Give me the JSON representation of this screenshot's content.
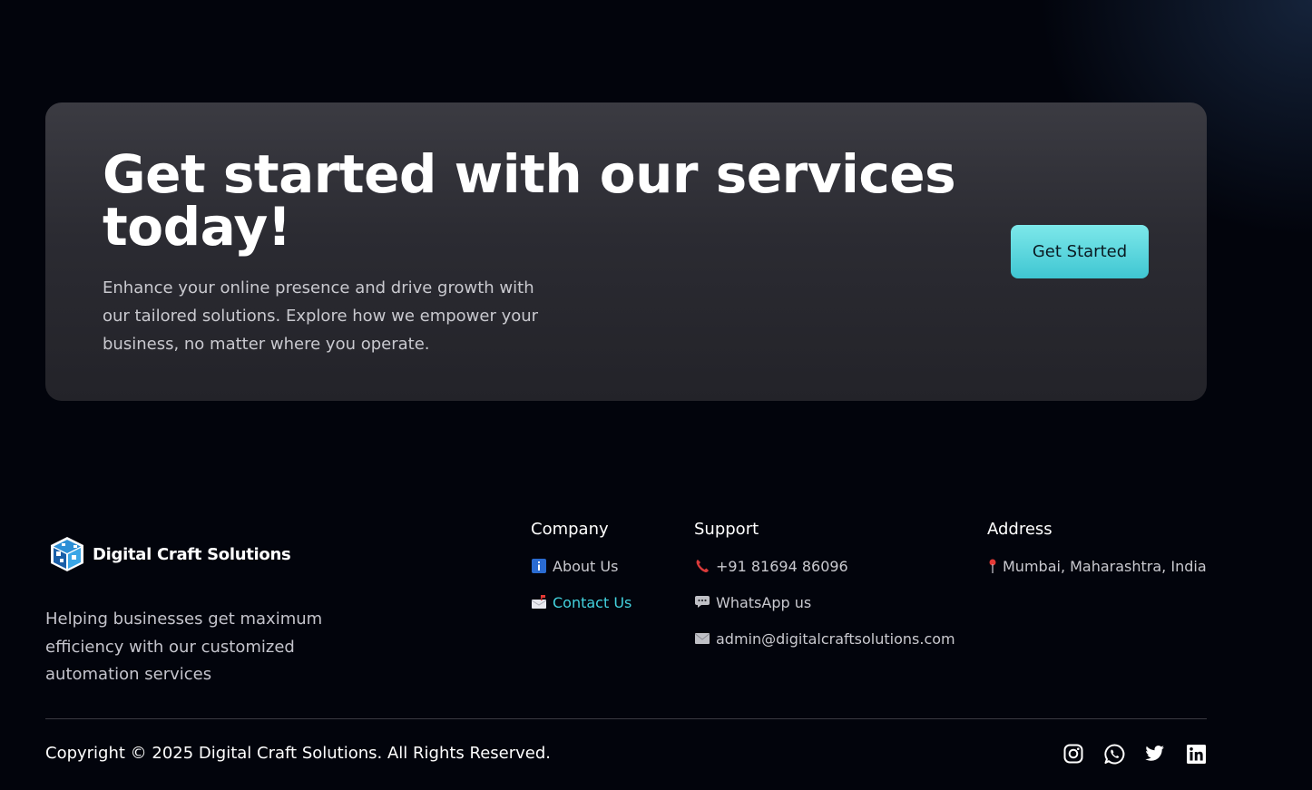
{
  "cta": {
    "heading": "Get started with our services today!",
    "description": "Enhance your online presence and drive growth with our tailored solutions. Explore how we empower your business, no matter where you operate.",
    "button_label": "Get Started"
  },
  "brand": {
    "name": "Digital Craft Solutions",
    "tagline": "Helping businesses get maximum efficiency with our customized automation services"
  },
  "company": {
    "title": "Company",
    "items": [
      {
        "label": "About Us",
        "icon": "info-icon"
      },
      {
        "label": "Contact Us",
        "icon": "mailbox-icon",
        "active": true
      }
    ]
  },
  "support": {
    "title": "Support",
    "items": [
      {
        "label": "+91 81694 86096",
        "icon": "phone-icon"
      },
      {
        "label": "WhatsApp us",
        "icon": "chat-icon"
      },
      {
        "label": "admin@digitalcraftsolutions.com",
        "icon": "envelope-icon"
      }
    ]
  },
  "address": {
    "title": "Address",
    "items": [
      {
        "label": "Mumbai, Maharashtra, India",
        "icon": "pin-icon"
      }
    ]
  },
  "footer": {
    "copyright": "Copyright © 2025 Digital Craft Solutions. All Rights Reserved.",
    "socials": [
      "instagram-icon",
      "whatsapp-icon",
      "twitter-icon",
      "linkedin-icon"
    ]
  },
  "colors": {
    "accent": "#43d2de",
    "background": "#02040c",
    "card": "#2f2f36"
  }
}
